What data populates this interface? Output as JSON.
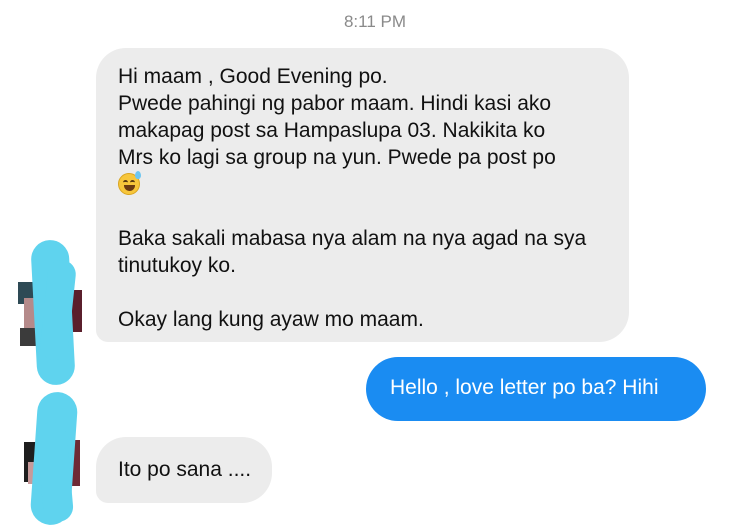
{
  "header": {
    "timestamp": "8:11 PM"
  },
  "messages": {
    "first": {
      "lines_a": [
        "Hi maam , Good Evening po.",
        "Pwede pahingi ng pabor maam. Hindi kasi ako",
        "makapag post sa Hampaslupa 03. Nakikita ko",
        "Mrs ko lagi sa group na yun. Pwede pa post po"
      ],
      "emoji": "grinning-face-with-sweat-icon",
      "lines_b": [
        "Baka sakali mabasa nya alam na nya agad na sya",
        "tinutukoy ko."
      ],
      "lines_c": [
        "Okay lang kung ayaw mo maam."
      ]
    },
    "reply": {
      "text": "Hello , love letter po ba? Hihi"
    },
    "third": {
      "text": "Ito po sana ...."
    }
  },
  "colors": {
    "incoming_bubble": "#ececec",
    "outgoing_bubble": "#1a8cf2",
    "redaction": "#5fd3ee"
  }
}
